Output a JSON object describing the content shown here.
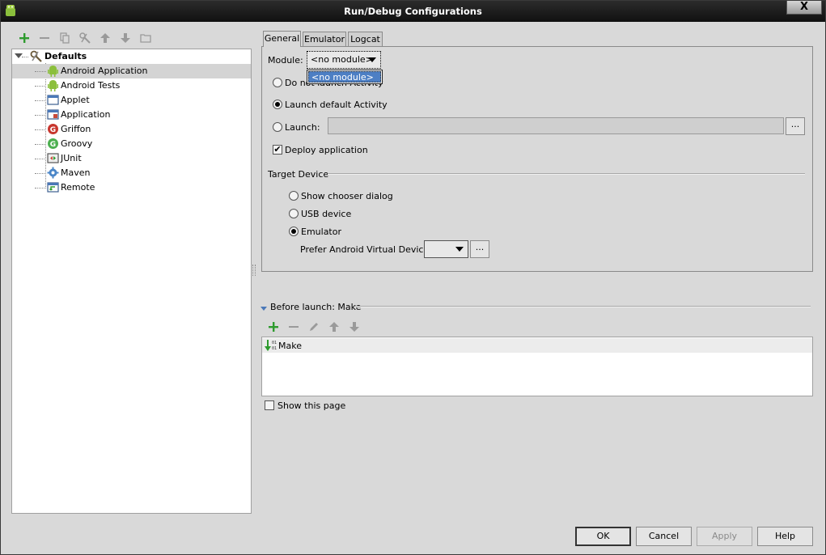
{
  "window": {
    "title": "Run/Debug Configurations",
    "close_label": "X"
  },
  "left_toolbar": {
    "icons": [
      "add-icon",
      "remove-icon",
      "copy-icon",
      "edit-defaults-icon",
      "move-up-icon",
      "move-down-icon",
      "folder-icon"
    ]
  },
  "tree": {
    "root": {
      "label": "Defaults"
    },
    "items": [
      {
        "label": "Android Application",
        "icon": "android-icon"
      },
      {
        "label": "Android Tests",
        "icon": "android-icon"
      },
      {
        "label": "Applet",
        "icon": "applet-icon"
      },
      {
        "label": "Application",
        "icon": "application-icon"
      },
      {
        "label": "Griffon",
        "icon": "griffon-icon"
      },
      {
        "label": "Groovy",
        "icon": "groovy-icon"
      },
      {
        "label": "JUnit",
        "icon": "junit-icon"
      },
      {
        "label": "Maven",
        "icon": "maven-gear-icon"
      },
      {
        "label": "Remote",
        "icon": "remote-icon"
      }
    ],
    "selected_index": 0
  },
  "tabs": [
    {
      "label": "General"
    },
    {
      "label": "Emulator"
    },
    {
      "label": "Logcat"
    }
  ],
  "general": {
    "module_label": "Module:",
    "module_value": "<no module>",
    "module_options": [
      "<no module>"
    ],
    "do_not_launch_label": "Do not launch Activity",
    "launch_default_label": "Launch default Activity",
    "launch_label": "Launch:",
    "launch_value": "",
    "dots_label": "...",
    "deploy_label": "Deploy application",
    "target_device_heading": "Target Device",
    "show_chooser_label": "Show chooser dialog",
    "usb_device_label": "USB device",
    "emulator_label": "Emulator",
    "prefer_avd_label": "Prefer Android Virtual Device:",
    "prefer_avd_value": ""
  },
  "before_launch": {
    "heading": "Before launch: Make",
    "items": [
      {
        "label": "Make"
      }
    ],
    "show_page_label": "Show this page"
  },
  "buttons": {
    "ok": "OK",
    "cancel": "Cancel",
    "apply": "Apply",
    "help": "Help"
  }
}
